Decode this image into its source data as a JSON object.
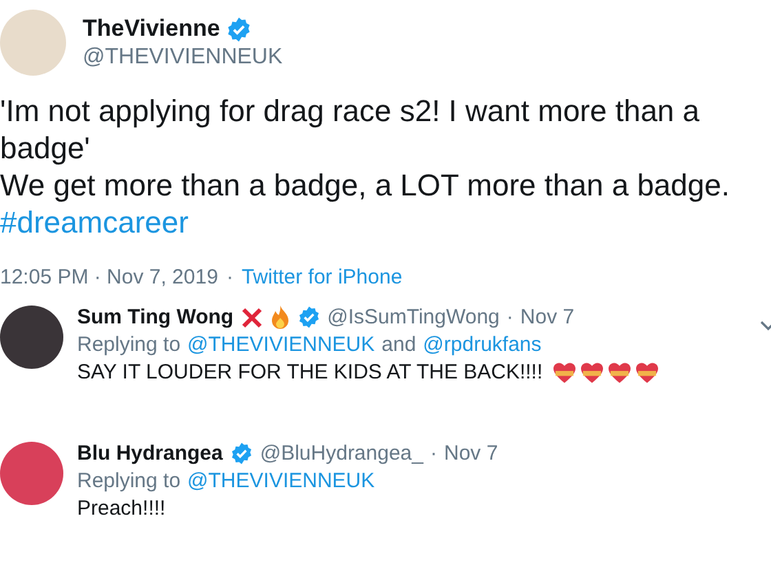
{
  "tweet": {
    "name": "TheVivienne",
    "verified": true,
    "handle": "@THEVIVIENNEUK",
    "text": "'Im not applying for drag race s2! I want more than a badge'",
    "text_2": "We get more than a badge, a LOT more than a badge.",
    "hashtag": "#dreamcareer",
    "time": "12:05 PM · Nov 7, 2019",
    "separator": "·",
    "source": "Twitter for iPhone"
  },
  "replies": [
    {
      "name": "Sum Ting Wong",
      "name_emoji": true,
      "verified": true,
      "handle": "@IsSumTingWong",
      "separator": "·",
      "date": "Nov 7",
      "replying_label": "Replying to",
      "mentions": [
        "@THEVIVIENNEUK",
        "@rpdrukfans"
      ],
      "joiner": "and",
      "text": "SAY IT LOUDER FOR THE KIDS AT THE BACK!!!!",
      "hearts": true,
      "menu": true
    },
    {
      "name": "Blu Hydrangea",
      "name_emoji": false,
      "verified": true,
      "handle": "@BluHydrangea_",
      "separator": "·",
      "date": "Nov 7",
      "replying_label": "Replying to",
      "mentions": [
        "@THEVIVIENNEUK"
      ],
      "text": "Preach!!!!",
      "hearts": false,
      "menu": false
    }
  ]
}
